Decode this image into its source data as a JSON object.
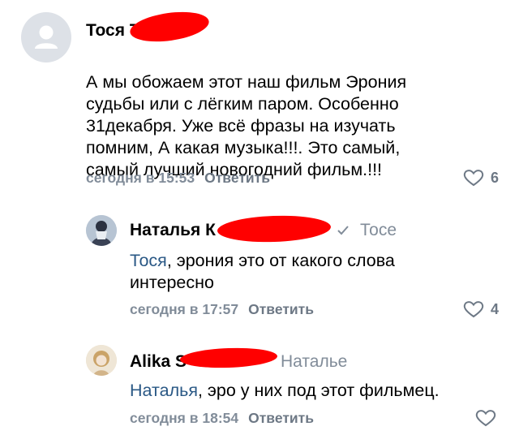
{
  "comments": [
    {
      "author": "Тося Т",
      "text": "А мы обожаем этот наш  фильм Эрония\nсудьбы или с лёгким паром. Особенно\n31декабря. Уже всё фразы на изучать\nпомним, А какая музыка!!!. Это  самый,\nсамый лучший новогодний фильм.!!!",
      "time": "сегодня в 15:53",
      "reply_label": "Ответить",
      "likes": "6"
    },
    {
      "author": "Наталья К",
      "reply_to": "Тосе",
      "mention": "Тося",
      "text": ", эрония это от какого слова\nинтересно",
      "time": "сегодня в 17:57",
      "reply_label": "Ответить",
      "likes": "4"
    },
    {
      "author": "Alika S",
      "reply_to": "Наталье",
      "mention": "Наталья",
      "text": ", эро у них под этот фильмец.",
      "time": "сегодня в 18:54",
      "reply_label": "Ответить",
      "likes": ""
    }
  ],
  "colors": {
    "link": "#2a5885",
    "meta": "#818c99",
    "redaction": "#ff0000"
  }
}
